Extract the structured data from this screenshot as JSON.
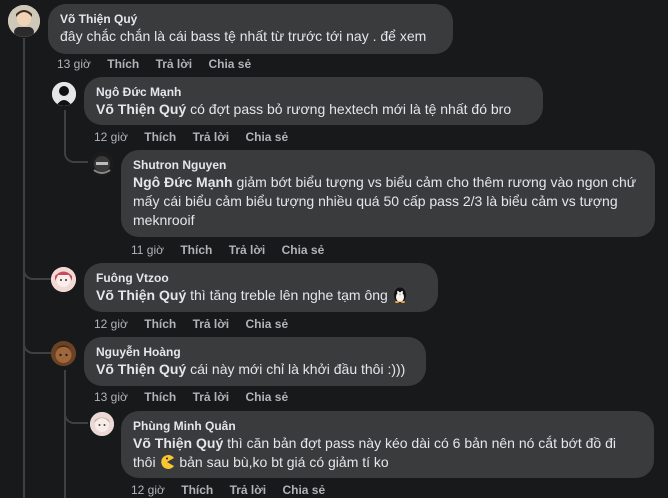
{
  "comments": [
    {
      "author": "Võ Thiện Quý",
      "text": "đây chắc chắn là cái bass tệ nhất từ trước tới nay . để xem",
      "time": "13 giờ",
      "like": "Thích",
      "reply": "Trả lời",
      "share": "Chia sẻ"
    },
    {
      "author": "Ngô Đức Mạnh",
      "mention": "Võ Thiện Quý",
      "text": " có đợt pass bỏ rương hextech mới là tệ nhất đó bro",
      "time": "12 giờ",
      "like": "Thích",
      "reply": "Trả lời",
      "share": "Chia sẻ"
    },
    {
      "author": "Shutron Nguyen",
      "mention": "Ngô Đức Mạnh",
      "text": " giảm bớt biểu tượng vs biểu cảm cho thêm rương vào ngon chứ mấy cái biểu cảm biểu tượng nhiều quá 50 cấp pass 2/3 là biểu cảm vs tượng meknrooif",
      "time": "11 giờ",
      "like": "Thích",
      "reply": "Trả lời",
      "share": "Chia sẻ"
    },
    {
      "author": "Fuông Vtzoo",
      "mention": "Võ Thiện Quý",
      "text": " thì tăng treble lên nghe tạm ông",
      "emoji": "penguin-emoji",
      "time": "12 giờ",
      "like": "Thích",
      "reply": "Trả lời",
      "share": "Chia sẻ"
    },
    {
      "author": "Nguyễn Hoàng",
      "mention": "Võ Thiện Quý",
      "text": " cái này mới chỉ là khởi đầu thôi :)))",
      "time": "13 giờ",
      "like": "Thích",
      "reply": "Trả lời",
      "share": "Chia sẻ"
    },
    {
      "author": "Phùng Minh Quân",
      "mention": "Võ Thiện Quý",
      "text": " thì căn bản đợt pass này kéo dài có 6 bản nên nó cắt bớt đồ đi thôi",
      "text2": " bản sau bù,ko bt giá có giảm tí ko",
      "emoji": "pacman-emoji",
      "time": "12 giờ",
      "like": "Thích",
      "reply": "Trả lời",
      "share": "Chia sẻ"
    }
  ],
  "colors": {
    "background": "#18191a",
    "bubble": "#3a3b3c",
    "text": "#e4e6eb",
    "meta": "#b0b3b8",
    "thread_line": "#3e4042"
  }
}
